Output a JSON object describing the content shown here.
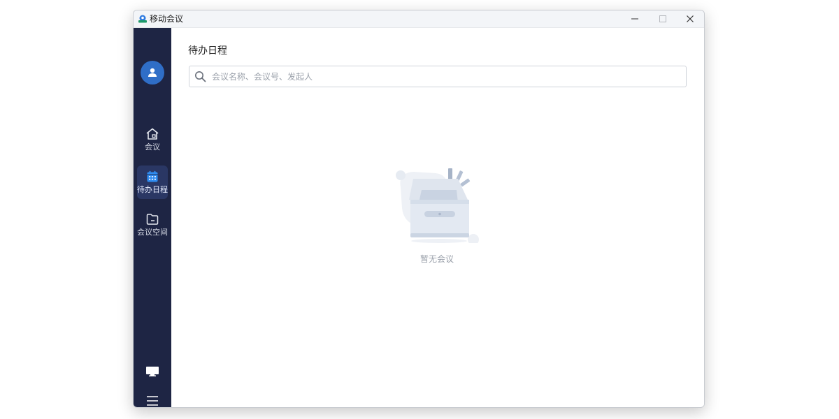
{
  "window": {
    "title": "移动会议"
  },
  "colors": {
    "sidebar_bg": "#1e2544",
    "sidebar_active": "#2a3764",
    "accent": "#2f7be0",
    "avatar_bg": "#2f6ec7"
  },
  "sidebar": {
    "items": [
      {
        "label": "会议",
        "icon": "home-icon",
        "active": false
      },
      {
        "label": "待办日程",
        "icon": "calendar-icon",
        "active": true
      },
      {
        "label": "会议空间",
        "icon": "folder-icon",
        "active": false
      }
    ],
    "bottom": [
      {
        "icon": "monitor-icon"
      },
      {
        "icon": "menu-icon"
      }
    ]
  },
  "main": {
    "title": "待办日程",
    "search": {
      "placeholder": "会议名称、会议号、发起人",
      "value": ""
    },
    "empty_state": {
      "text": "暂无会议",
      "icon": "empty-box-icon"
    }
  }
}
